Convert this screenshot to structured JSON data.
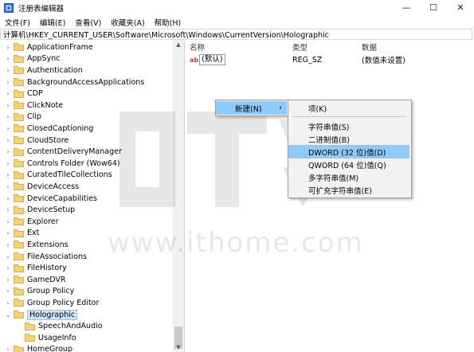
{
  "window": {
    "title": "注册表编辑器",
    "minimize": "—",
    "maximize": "☐",
    "close": "✕"
  },
  "menu": [
    "文件(F)",
    "编辑(E)",
    "查看(V)",
    "收藏夹(A)",
    "帮助(H)"
  ],
  "address": "计算机\\HKEY_CURRENT_USER\\Software\\Microsoft\\Windows\\CurrentVersion\\Holographic",
  "tree": [
    {
      "label": "ApplicationFrame",
      "expander": "›",
      "level": 0
    },
    {
      "label": "AppSync",
      "expander": "›",
      "level": 0
    },
    {
      "label": "Authentication",
      "expander": "›",
      "level": 0
    },
    {
      "label": "BackgroundAccessApplications",
      "expander": "›",
      "level": 0
    },
    {
      "label": "CDP",
      "expander": "›",
      "level": 0
    },
    {
      "label": "ClickNote",
      "expander": "›",
      "level": 0
    },
    {
      "label": "Clip",
      "expander": "›",
      "level": 0
    },
    {
      "label": "ClosedCaptioning",
      "expander": "›",
      "level": 0
    },
    {
      "label": "CloudStore",
      "expander": "›",
      "level": 0
    },
    {
      "label": "ContentDeliveryManager",
      "expander": "›",
      "level": 0
    },
    {
      "label": "Controls Folder (Wow64)",
      "expander": "›",
      "level": 0
    },
    {
      "label": "CuratedTileCollections",
      "expander": "›",
      "level": 0
    },
    {
      "label": "DeviceAccess",
      "expander": "›",
      "level": 0
    },
    {
      "label": "DeviceCapabilities",
      "expander": "›",
      "level": 0
    },
    {
      "label": "DeviceSetup",
      "expander": "›",
      "level": 0
    },
    {
      "label": "Explorer",
      "expander": "›",
      "level": 0
    },
    {
      "label": "Ext",
      "expander": "›",
      "level": 0
    },
    {
      "label": "Extensions",
      "expander": "›",
      "level": 0
    },
    {
      "label": "FileAssociations",
      "expander": "›",
      "level": 0
    },
    {
      "label": "FileHistory",
      "expander": "›",
      "level": 0
    },
    {
      "label": "GameDVR",
      "expander": "›",
      "level": 0
    },
    {
      "label": "Group Policy",
      "expander": "›",
      "level": 0
    },
    {
      "label": "Group Policy Editor",
      "expander": "›",
      "level": 0
    },
    {
      "label": "Holographic",
      "expander": "⌄",
      "level": 0,
      "selected": true
    },
    {
      "label": "SpeechAndAudio",
      "expander": "",
      "level": 1
    },
    {
      "label": "UsageInfo",
      "expander": "",
      "level": 1
    },
    {
      "label": "HomeGroup",
      "expander": "›",
      "level": 0
    }
  ],
  "tree_scroll": {
    "up": "▲",
    "down": "▼"
  },
  "columns": {
    "name": "名称",
    "type": "类型",
    "data": "数据"
  },
  "values": [
    {
      "icon": "ab",
      "name": "(默认)",
      "type": "REG_SZ",
      "data": "(数值未设置)"
    }
  ],
  "context_menu": {
    "item": "新建(N)",
    "arrow": "›"
  },
  "submenu": [
    {
      "label": "项(K)"
    },
    {
      "separator": true
    },
    {
      "label": "字符串值(S)"
    },
    {
      "label": "二进制值(B)"
    },
    {
      "label": "DWORD (32 位)值(D)",
      "highlighted": true
    },
    {
      "label": "QWORD (64 位)值(Q)"
    },
    {
      "label": "多字符串值(M)"
    },
    {
      "label": "可扩充字符串值(E)"
    }
  ],
  "watermark": "www.ithome.com"
}
